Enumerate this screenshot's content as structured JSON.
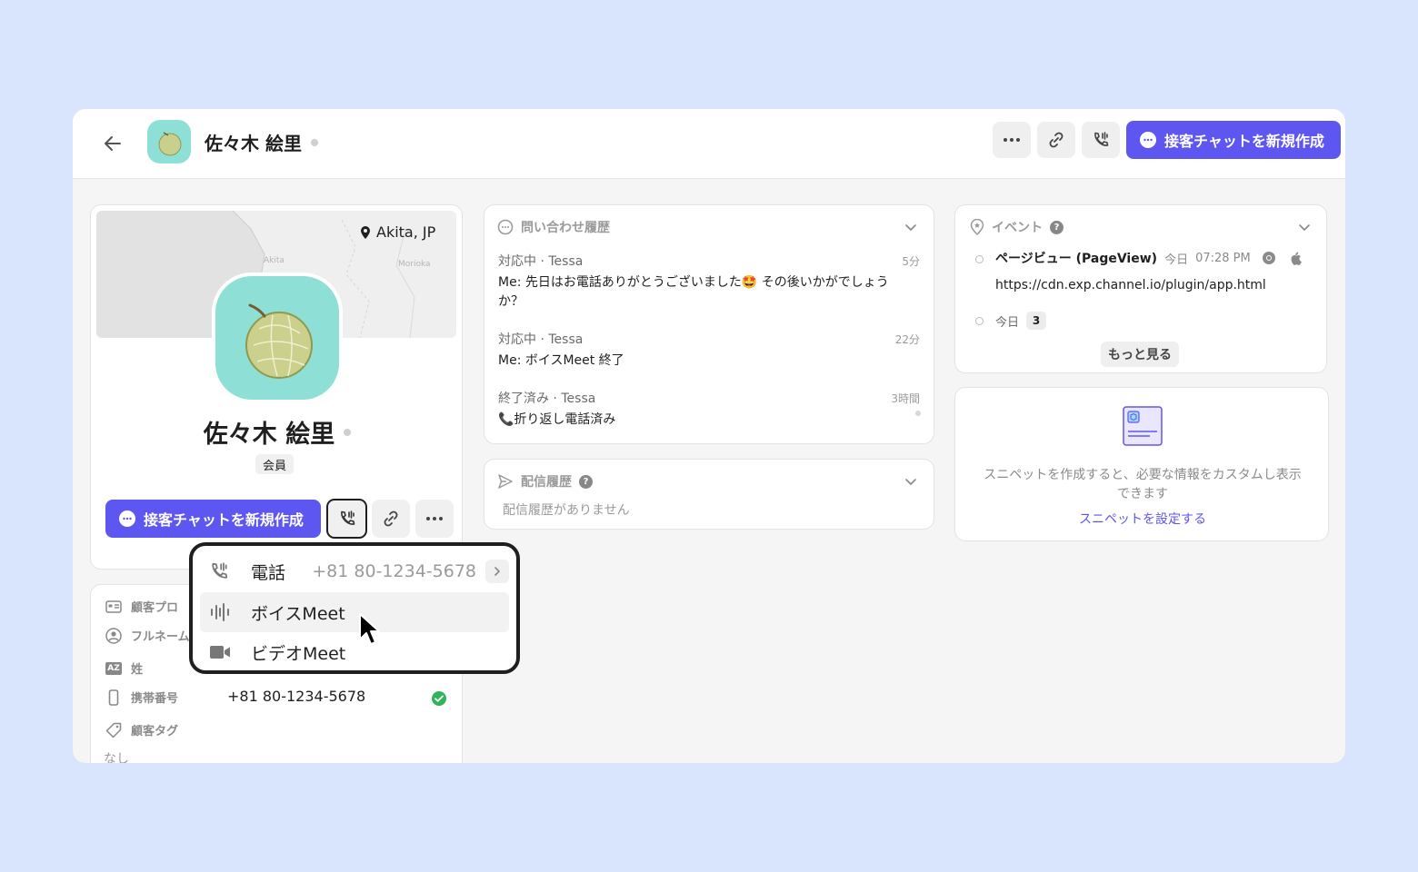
{
  "header": {
    "name": "佐々木 絵里",
    "new_chat_label": "接客チャットを新規作成"
  },
  "profile": {
    "location": "Akita, JP",
    "map_label_akita": "Akita",
    "map_label_morioka": "Morioka",
    "name": "佐々木 絵里",
    "member_badge": "会員",
    "new_chat_label": "接客チャットを新規作成"
  },
  "call_menu": {
    "items": [
      {
        "label": "電話",
        "value": "+81 80-1234-5678",
        "icon": "phone-icon"
      },
      {
        "label": "ボイスMeet",
        "icon": "voice-wave-icon"
      },
      {
        "label": "ビデオMeet",
        "icon": "video-camera-icon"
      }
    ]
  },
  "customer_profile": {
    "title": "顧客プロ",
    "fields": [
      {
        "label": "フルネーム",
        "value": ""
      },
      {
        "label": "姓",
        "value": ""
      },
      {
        "label": "携帯番号",
        "value": "+81 80-1234-5678"
      },
      {
        "label": "顧客タグ",
        "value": ""
      }
    ],
    "tags_value": "なし"
  },
  "inquiries": {
    "title": "問い合わせ履歴",
    "items": [
      {
        "status": "対応中",
        "agent": "Tessa",
        "time": "5分",
        "message": "Me: 先日はお電話ありがとうございました🤩 その後いかがでしょうか？"
      },
      {
        "status": "対応中",
        "agent": "Tessa",
        "time": "22分",
        "message": "Me: ボイスMeet 終了"
      },
      {
        "status": "終了済み",
        "agent": "Tessa",
        "time": "3時間",
        "message": "📞折り返し電話済み"
      }
    ]
  },
  "delivery": {
    "title": "配信履歴",
    "empty": "配信履歴がありません"
  },
  "events": {
    "title": "イベント",
    "event_name": "ページビュー (PageView)",
    "event_day": "今日",
    "event_time": "07:28 PM",
    "event_url": "https://cdn.exp.channel.io/plugin/app.html",
    "group_day": "今日",
    "group_count": "3",
    "more_label": "もっと見る"
  },
  "snippet": {
    "description": "スニペットを作成すると、必要な情報をカスタムし表示できます",
    "link": "スニペットを設定する"
  },
  "colors": {
    "accent": "#5e56f0",
    "avatar_bg": "#8ee0d7",
    "verified": "#2fb45a"
  }
}
